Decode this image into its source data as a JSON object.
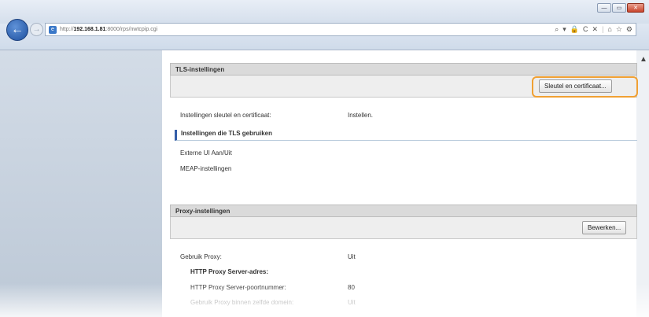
{
  "browser": {
    "url_prefix": "http://",
    "url_host": "192.168.1.81",
    "url_path": ":8000/rps/nwtcpip.cgi",
    "win_min": "—",
    "win_max": "▭",
    "win_close": "✕",
    "tools": [
      "⌕",
      "▾",
      "🔒",
      "C",
      "✕"
    ],
    "tab_icons": [
      "⌂",
      "☆",
      "⚙"
    ]
  },
  "tls": {
    "header": "TLS-instellingen",
    "button": "Sleutel en certificaat...",
    "key_label": "Instellingen sleutel en certificaat:",
    "key_value": "Instellen.",
    "subsection": "Instellingen die TLS gebruiken",
    "links": [
      "Externe UI Aan/Uit",
      "MEAP-instellingen"
    ]
  },
  "proxy": {
    "header": "Proxy-instellingen",
    "button": "Bewerken...",
    "rows": [
      {
        "label": "Gebruik Proxy:",
        "value": "Uit",
        "bold": false
      },
      {
        "label": "HTTP Proxy Server-adres:",
        "value": "",
        "bold": true
      },
      {
        "label": "HTTP Proxy Server-poortnummer:",
        "value": "80",
        "bold": false
      },
      {
        "label": "Gebruik Proxy binnen zelfde domein:",
        "value": "Uit",
        "bold": false
      }
    ]
  }
}
